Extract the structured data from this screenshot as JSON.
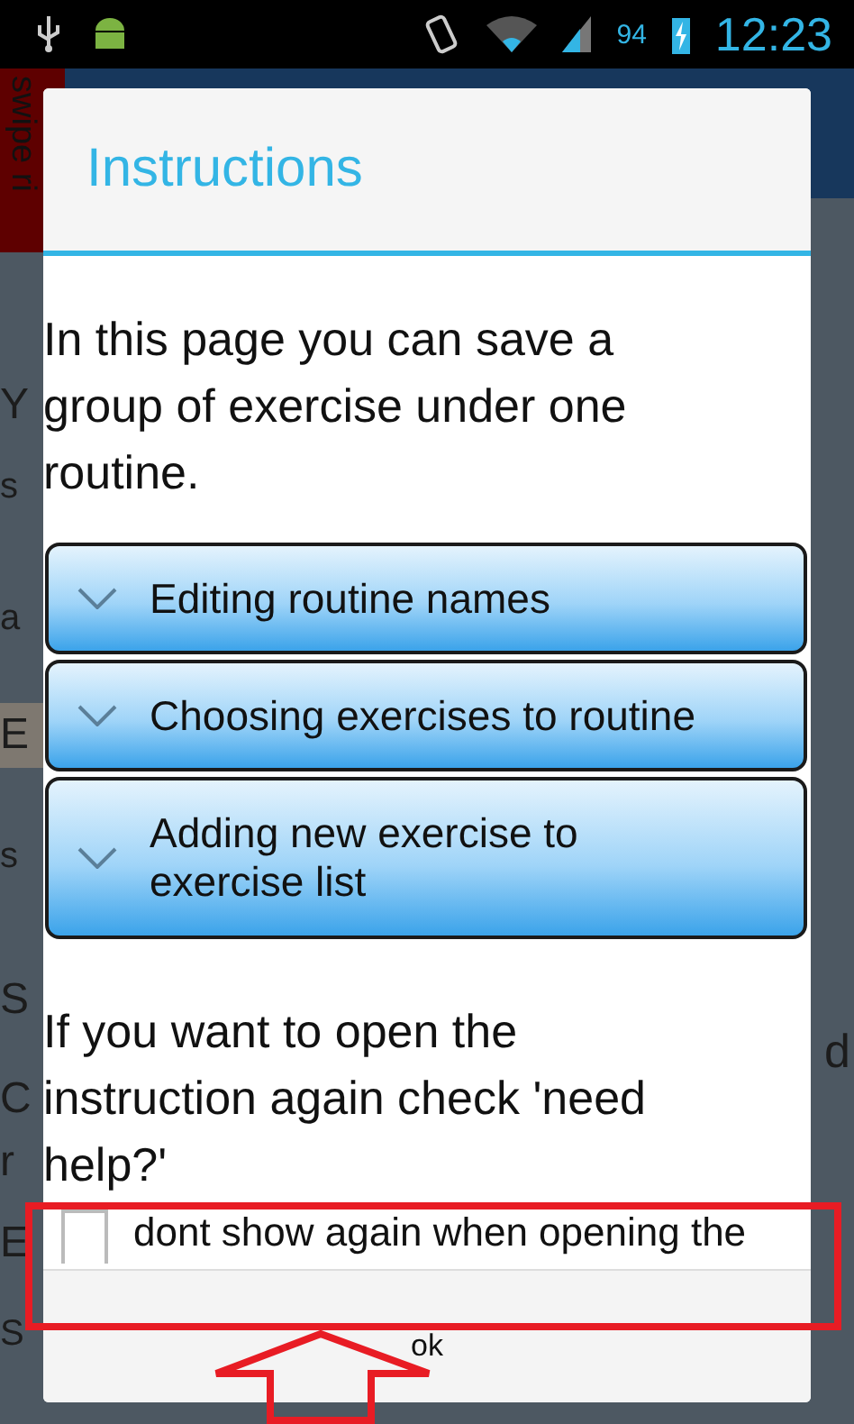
{
  "status_bar": {
    "battery": "94",
    "time": "12:23"
  },
  "background": {
    "swipe_tab": "swipe ri",
    "fragments": [
      {
        "text": "Y",
        "kind": "large"
      },
      {
        "text": "s",
        "kind": "small"
      },
      {
        "text": "a",
        "kind": "small"
      },
      {
        "text": "E",
        "kind": "highlight"
      },
      {
        "text": "s",
        "kind": "small"
      },
      {
        "text": "S",
        "kind": "large"
      },
      {
        "text": "C",
        "kind": "large"
      },
      {
        "text": "r",
        "kind": "large"
      },
      {
        "text": "E",
        "kind": "large"
      },
      {
        "text": "S",
        "kind": "small"
      }
    ],
    "right_fragment": "d"
  },
  "dialog": {
    "title": "Instructions",
    "intro": "In this page you can save a group of exercise under one routine.",
    "sections": [
      {
        "label": "Editing routine names",
        "expanded": false
      },
      {
        "label": "Choosing exercises to routine",
        "expanded": false
      },
      {
        "label": "Adding new exercise to exercise list",
        "expanded": false
      }
    ],
    "note": "If you want to open the instruction again check 'need help?'",
    "checkbox": {
      "label": "dont show again when opening the",
      "checked": false
    },
    "buttons": [
      "ok"
    ]
  }
}
